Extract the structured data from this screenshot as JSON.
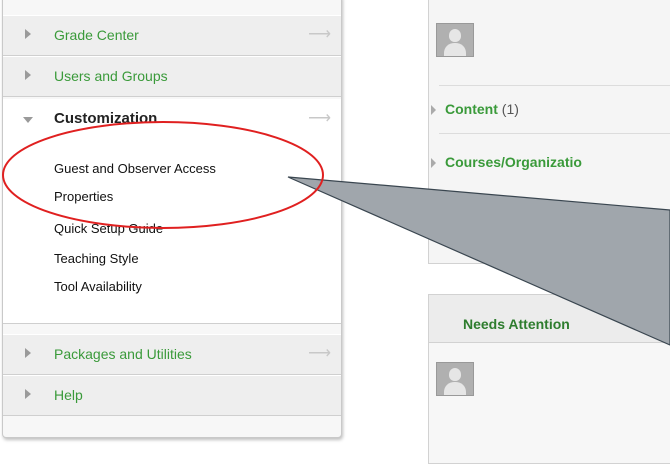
{
  "control_panel": {
    "sections": [
      {
        "label": "Grade Center",
        "expanded": false
      },
      {
        "label": "Users and Groups",
        "expanded": false
      },
      {
        "label": "Customization",
        "expanded": true
      },
      {
        "label": "Packages and Utilities",
        "expanded": false
      },
      {
        "label": "Help",
        "expanded": false
      }
    ],
    "customization_items": [
      "Guest and Observer Access",
      "Properties",
      "Quick Setup Guide",
      "Teaching Style",
      "Tool Availability"
    ]
  },
  "my_groups": {
    "content_label": "Content",
    "content_count": "(1)",
    "courses_label": "Courses/Organizatio"
  },
  "needs_attention": {
    "title": "Needs Attention"
  },
  "colors": {
    "link_green": "#3a9a3a",
    "annotation_red": "#e02020",
    "callout_gray": "#a0a6ac"
  }
}
